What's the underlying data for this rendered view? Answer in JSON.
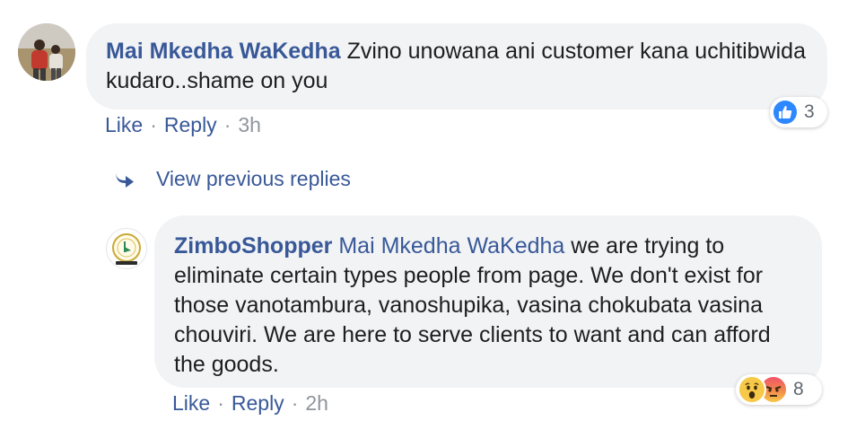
{
  "comments": [
    {
      "author": "Mai Mkedha WaKedha",
      "text": " Zvino unowana ani customer kana uchitibwida kudaro..shame on you",
      "actions": {
        "like": "Like",
        "separator": "·",
        "reply": "Reply",
        "time": "3h"
      },
      "reactions": {
        "icons": [
          "like-icon"
        ],
        "count": "3"
      }
    },
    {
      "author": "ZimboShopper",
      "mention": "Mai Mkedha WaKedha",
      "text": " we are trying to eliminate certain types people from page. We don't exist for those vanotambura, vanoshupika, vasina chokubata vasina chouviri. We are here to serve clients to want and can afford the goods.",
      "actions": {
        "like": "Like",
        "separator": "·",
        "reply": "Reply",
        "time": "2h"
      },
      "reactions": {
        "icons": [
          "wow-icon",
          "angry-icon"
        ],
        "count": "8"
      }
    }
  ],
  "view_previous_replies": {
    "label": "View previous replies",
    "icon": "reply-arrow-icon"
  },
  "colors": {
    "link": "#385898",
    "bubble": "#f2f3f5",
    "muted": "#90949c",
    "like_blue": "#2d88ff"
  }
}
